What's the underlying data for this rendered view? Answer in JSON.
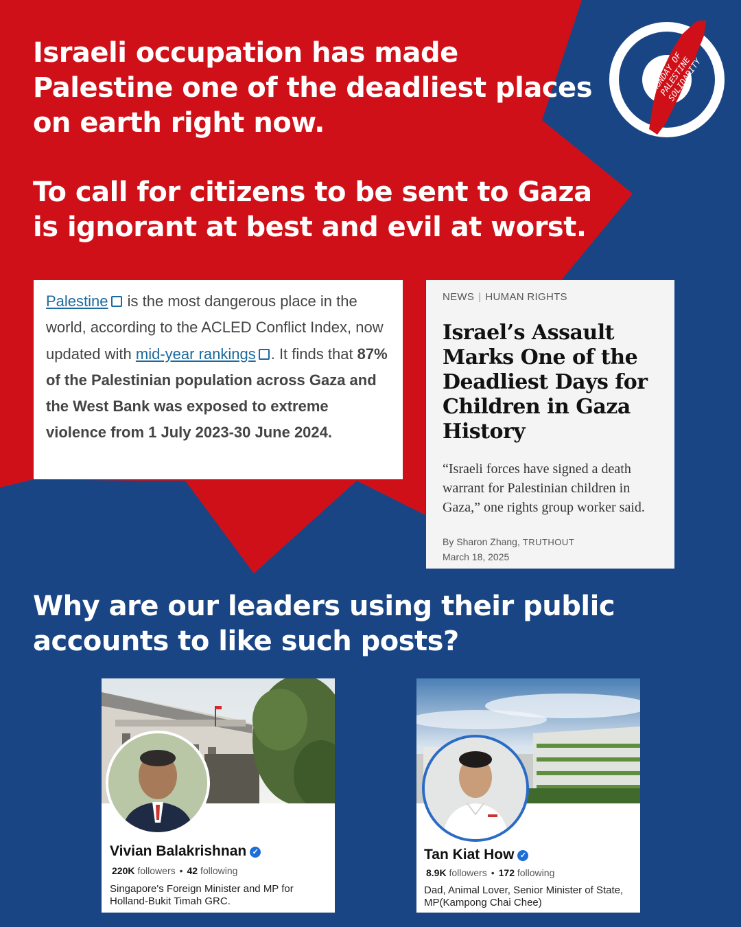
{
  "headline_top": {
    "line1": "Israeli occupation has made",
    "line2": "Palestine one of the deadliest places",
    "line3": "on earth right now."
  },
  "headline_mid": {
    "line1": "To call for citizens to be sent to Gaza",
    "line2": "is ignorant at best and evil at worst."
  },
  "headline_bottom": {
    "line1": "Why are our leaders using their public",
    "line2": "accounts to like such posts?"
  },
  "logo": {
    "line1": "MONDAY OF",
    "line2": "PALESTINE",
    "line3": "SOLIDARITY"
  },
  "acled_card": {
    "link1": "Palestine",
    "text1": " is the most dangerous place in the world, according to the ACLED Conflict Index, now updated with ",
    "link2": "mid-year rankings",
    "text2": ". It finds that ",
    "bold": "87% of the Palestinian population across Gaza and the West Bank was exposed to extreme violence from 1 July 2023-30 June 2024."
  },
  "news_card": {
    "category1": "NEWS",
    "category2": "HUMAN RIGHTS",
    "title": "Israel’s Assault Marks One of the Deadliest Days for Children in Gaza History",
    "quote": "“Israeli forces have signed a death warrant for Palestinian children in Gaza,” one rights group worker said.",
    "byline_prefix": "By Sharon Zhang, ",
    "publication": "TRUTHOUT",
    "date": "March 18, 2025"
  },
  "profiles": [
    {
      "name": "Vivian Balakrishnan",
      "followers": "220K",
      "followers_label": "followers",
      "following": "42",
      "following_label": "following",
      "bio": "Singapore's Foreign Minister and MP for Holland-Bukit Timah GRC."
    },
    {
      "name": "Tan Kiat How",
      "followers": "8.9K",
      "followers_label": "followers",
      "following": "172",
      "following_label": "following",
      "bio": "Dad, Animal Lover, Senior Minister of State, MP(Kampong Chai Chee)"
    }
  ],
  "colors": {
    "background_blue": "#1a4585",
    "burst_red": "#cf1018",
    "text_white": "#ffffff",
    "verified_blue": "#1d6fd6"
  }
}
